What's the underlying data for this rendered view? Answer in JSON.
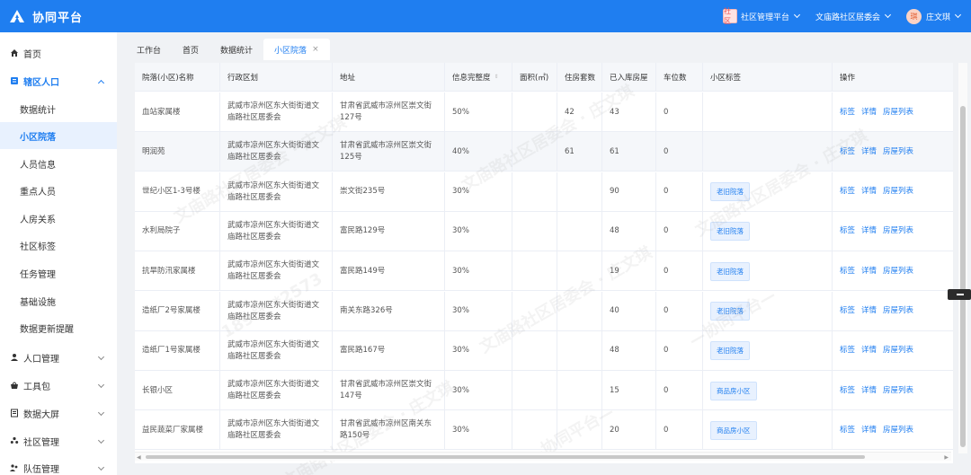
{
  "header": {
    "title": "协同平台",
    "platform_badge": "社区",
    "platform_label": "社区管理平台",
    "committee_label": "文庙路社区居委会",
    "avatar_char": "琪",
    "user_name": "庄文琪",
    "brand_color": "#1f7ef0"
  },
  "sidebar": {
    "items": [
      {
        "label": "首页",
        "icon": "home-icon"
      },
      {
        "label": "辖区人口",
        "icon": "grid-icon"
      },
      {
        "label": "数据统计"
      },
      {
        "label": "小区院落"
      },
      {
        "label": "人员信息"
      },
      {
        "label": "重点人员"
      },
      {
        "label": "人房关系"
      },
      {
        "label": "社区标签"
      },
      {
        "label": "任务管理"
      },
      {
        "label": "基础设施"
      },
      {
        "label": "数据更新提醒"
      },
      {
        "label": "人口管理",
        "icon": "user-icon"
      },
      {
        "label": "工具包",
        "icon": "bag-icon"
      },
      {
        "label": "数据大屏",
        "icon": "screen-icon"
      },
      {
        "label": "社区管理",
        "icon": "people-icon"
      },
      {
        "label": "队伍管理",
        "icon": "team-icon"
      }
    ]
  },
  "tabs": [
    {
      "label": "工作台"
    },
    {
      "label": "首页"
    },
    {
      "label": "数据统计"
    },
    {
      "label": "小区院落",
      "close": "×"
    }
  ],
  "table": {
    "columns": [
      "院落(小区)名称",
      "行政区划",
      "地址",
      "信息完整度",
      "面积(㎡)",
      "住房套数",
      "已入库房屋",
      "车位数",
      "小区标签",
      "操作"
    ],
    "sort_icon": "⇕",
    "actions": [
      "标签",
      "详情",
      "房屋列表"
    ],
    "rows": [
      {
        "name": "血站家属楼",
        "district": "武威市凉州区东大街街道文庙路社区居委会",
        "address": "甘肃省武威市凉州区崇文街127号",
        "completeness": "50%",
        "area": "",
        "housing": "42",
        "stored": "43",
        "parking": "0",
        "tag": ""
      },
      {
        "name": "明润苑",
        "district": "武威市凉州区东大街街道文庙路社区居委会",
        "address": "甘肃省武威市凉州区崇文街125号",
        "completeness": "40%",
        "area": "",
        "housing": "61",
        "stored": "61",
        "parking": "0",
        "tag": ""
      },
      {
        "name": "世纪小区1-3号楼",
        "district": "武威市凉州区东大街街道文庙路社区居委会",
        "address": "崇文街235号",
        "completeness": "30%",
        "area": "",
        "housing": "",
        "stored": "90",
        "parking": "0",
        "tag": "老旧院落"
      },
      {
        "name": "水利局院子",
        "district": "武威市凉州区东大街街道文庙路社区居委会",
        "address": "富民路129号",
        "completeness": "30%",
        "area": "",
        "housing": "",
        "stored": "48",
        "parking": "0",
        "tag": "老旧院落"
      },
      {
        "name": "抗旱防汛家属楼",
        "district": "武威市凉州区东大街街道文庙路社区居委会",
        "address": "富民路149号",
        "completeness": "30%",
        "area": "",
        "housing": "",
        "stored": "19",
        "parking": "0",
        "tag": "老旧院落"
      },
      {
        "name": "造纸厂2号家属楼",
        "district": "武威市凉州区东大街街道文庙路社区居委会",
        "address": "南关东路326号",
        "completeness": "30%",
        "area": "",
        "housing": "",
        "stored": "40",
        "parking": "0",
        "tag": "老旧院落"
      },
      {
        "name": "造纸厂1号家属楼",
        "district": "武威市凉州区东大街街道文庙路社区居委会",
        "address": "富民路167号",
        "completeness": "30%",
        "area": "",
        "housing": "",
        "stored": "48",
        "parking": "0",
        "tag": "老旧院落"
      },
      {
        "name": "长银小区",
        "district": "武威市凉州区东大街街道文庙路社区居委会",
        "address": "甘肃省武威市凉州区崇文街147号",
        "completeness": "30%",
        "area": "",
        "housing": "",
        "stored": "15",
        "parking": "0",
        "tag": "商品房小区"
      },
      {
        "name": "益民蔬菜厂家属楼",
        "district": "武威市凉州区东大街街道文庙路社区居委会",
        "address": "甘肃省武威市凉州区南关东路150号",
        "completeness": "30%",
        "area": "",
        "housing": "",
        "stored": "20",
        "parking": "0",
        "tag": "商品房小区"
      }
    ]
  },
  "watermark": [
    "文庙路社区居委会 · 庄文琪",
    "189****2573",
    "—协同平台—"
  ]
}
